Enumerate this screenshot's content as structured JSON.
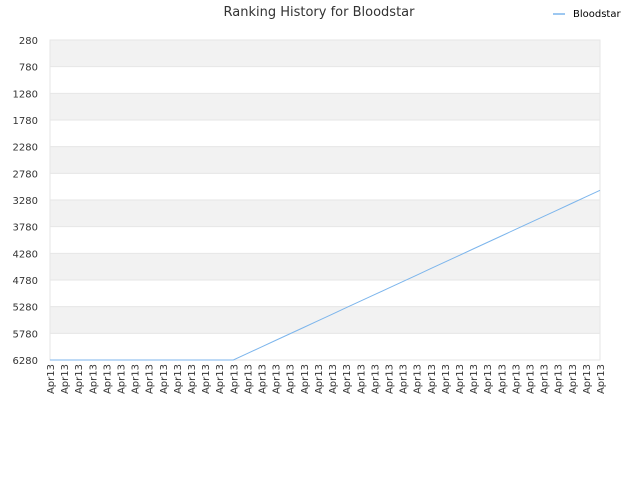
{
  "chart_data": {
    "type": "line",
    "title": "Ranking History for Bloodstar",
    "xlabel": "",
    "ylabel": "",
    "y_inverted": true,
    "ylim": [
      6280,
      280
    ],
    "y_ticks": [
      280,
      780,
      1280,
      1780,
      2280,
      2780,
      3280,
      3780,
      4280,
      4780,
      5280,
      5780,
      6280
    ],
    "categories": [
      "Apr13",
      "Apr13",
      "Apr13",
      "Apr13",
      "Apr13",
      "Apr13",
      "Apr13",
      "Apr13",
      "Apr13",
      "Apr13",
      "Apr13",
      "Apr13",
      "Apr13",
      "Apr13",
      "Apr13",
      "Apr13",
      "Apr13",
      "Apr13",
      "Apr13",
      "Apr13",
      "Apr13",
      "Apr13",
      "Apr13",
      "Apr13",
      "Apr13",
      "Apr13",
      "Apr13",
      "Apr13",
      "Apr13",
      "Apr13",
      "Apr13",
      "Apr13",
      "Apr13",
      "Apr13",
      "Apr13",
      "Apr13",
      "Apr13",
      "Apr13",
      "Apr13",
      "Apr13"
    ],
    "series": [
      {
        "name": "Bloodstar",
        "color": "#7cb5ec",
        "values": [
          6280,
          6280,
          6280,
          6280,
          6280,
          6280,
          6280,
          6280,
          6280,
          6280,
          6280,
          6280,
          6280,
          6280,
          6157,
          6035,
          5912,
          5790,
          5668,
          5546,
          5423,
          5300,
          5178,
          5056,
          4934,
          4811,
          4689,
          4566,
          4444,
          4322,
          4199,
          4077,
          3955,
          3832,
          3710,
          3588,
          3466,
          3343,
          3221,
          3098
        ]
      }
    ],
    "grid": true,
    "legend_position": "top-right",
    "band_colors": [
      "#f2f2f2",
      "#ffffff"
    ],
    "grid_color": "#e6e6e6",
    "axis_color": "#cccccc"
  }
}
